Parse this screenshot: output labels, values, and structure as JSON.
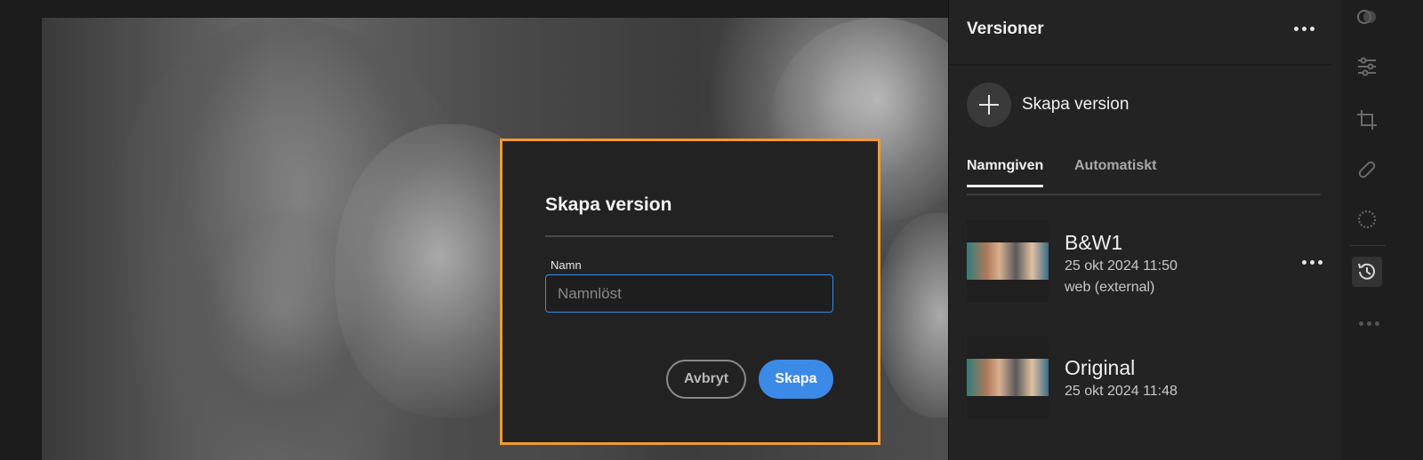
{
  "dialog": {
    "title": "Skapa version",
    "field_label": "Namn",
    "field_placeholder": "Namnlöst",
    "field_value": "",
    "cancel_label": "Avbryt",
    "create_label": "Skapa",
    "border_color": "#f29a33",
    "accent_color": "#3c8ae8"
  },
  "panel": {
    "title": "Versioner",
    "create_version_label": "Skapa version",
    "tabs": [
      {
        "label": "Namngiven",
        "active": true
      },
      {
        "label": "Automatiskt",
        "active": false
      }
    ],
    "versions": [
      {
        "name": "B&W1",
        "date": "25 okt 2024 11:50",
        "source": "web (external)"
      },
      {
        "name": "Original",
        "date": "25 okt 2024 11:48",
        "source": ""
      }
    ]
  },
  "toolbar": {
    "tools": [
      "presets-icon",
      "adjust-sliders-icon",
      "crop-icon",
      "heal-bandage-icon",
      "mask-icon",
      "history-icon",
      "more-icon"
    ],
    "active_tool": "history-icon"
  }
}
